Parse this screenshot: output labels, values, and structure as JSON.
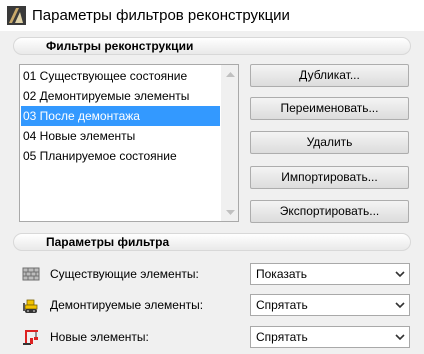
{
  "window": {
    "title": "Параметры фильтров реконструкции"
  },
  "filters_section": {
    "title": "Фильтры реконструкции",
    "items": [
      {
        "label": "01 Существующее состояние",
        "selected": false
      },
      {
        "label": "02 Демонтируемые элементы",
        "selected": false
      },
      {
        "label": "03 После демонтажа",
        "selected": true
      },
      {
        "label": "04 Новые элементы",
        "selected": false
      },
      {
        "label": "05 Планируемое состояние",
        "selected": false
      }
    ],
    "buttons": {
      "duplicate": "Дубликат...",
      "rename": "Переименовать...",
      "delete": "Удалить",
      "import": "Импортировать...",
      "export": "Экспортировать..."
    }
  },
  "params_section": {
    "title": "Параметры фильтра",
    "rows": [
      {
        "icon": "brick-wall-icon",
        "label": "Существующие элементы:",
        "value": "Показать"
      },
      {
        "icon": "bulldozer-icon",
        "label": "Демонтируемые элементы:",
        "value": "Спрятать"
      },
      {
        "icon": "crane-icon",
        "label": "Новые элементы:",
        "value": "Спрятать"
      }
    ]
  },
  "colors": {
    "selection": "#3399ff",
    "background": "#f0f0f0"
  }
}
